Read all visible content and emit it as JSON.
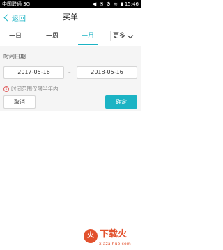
{
  "status_bar": {
    "carrier": "中国联通 3G",
    "icons": "◀ ✉ ⚙ ≋ ▮",
    "time": "15:46"
  },
  "nav": {
    "back_label": "返回",
    "title": "买单"
  },
  "tabs": [
    {
      "label": "一日",
      "active": false
    },
    {
      "label": "一周",
      "active": false
    },
    {
      "label": "一月",
      "active": true
    }
  ],
  "more_label": "更多",
  "panel": {
    "label": "时间日期",
    "start_date": "2017-05-16",
    "separator": "–",
    "end_date": "2018-05-16",
    "hint": "时间范围仅限半年内"
  },
  "buttons": {
    "cancel": "取消",
    "ok": "确定"
  },
  "watermark": {
    "logo": "火",
    "text": "下载火",
    "url": "xiazaihuo.com"
  },
  "colors": {
    "accent": "#1bb3c4",
    "panel_bg": "#f5f5f5",
    "warning": "#e06060"
  }
}
